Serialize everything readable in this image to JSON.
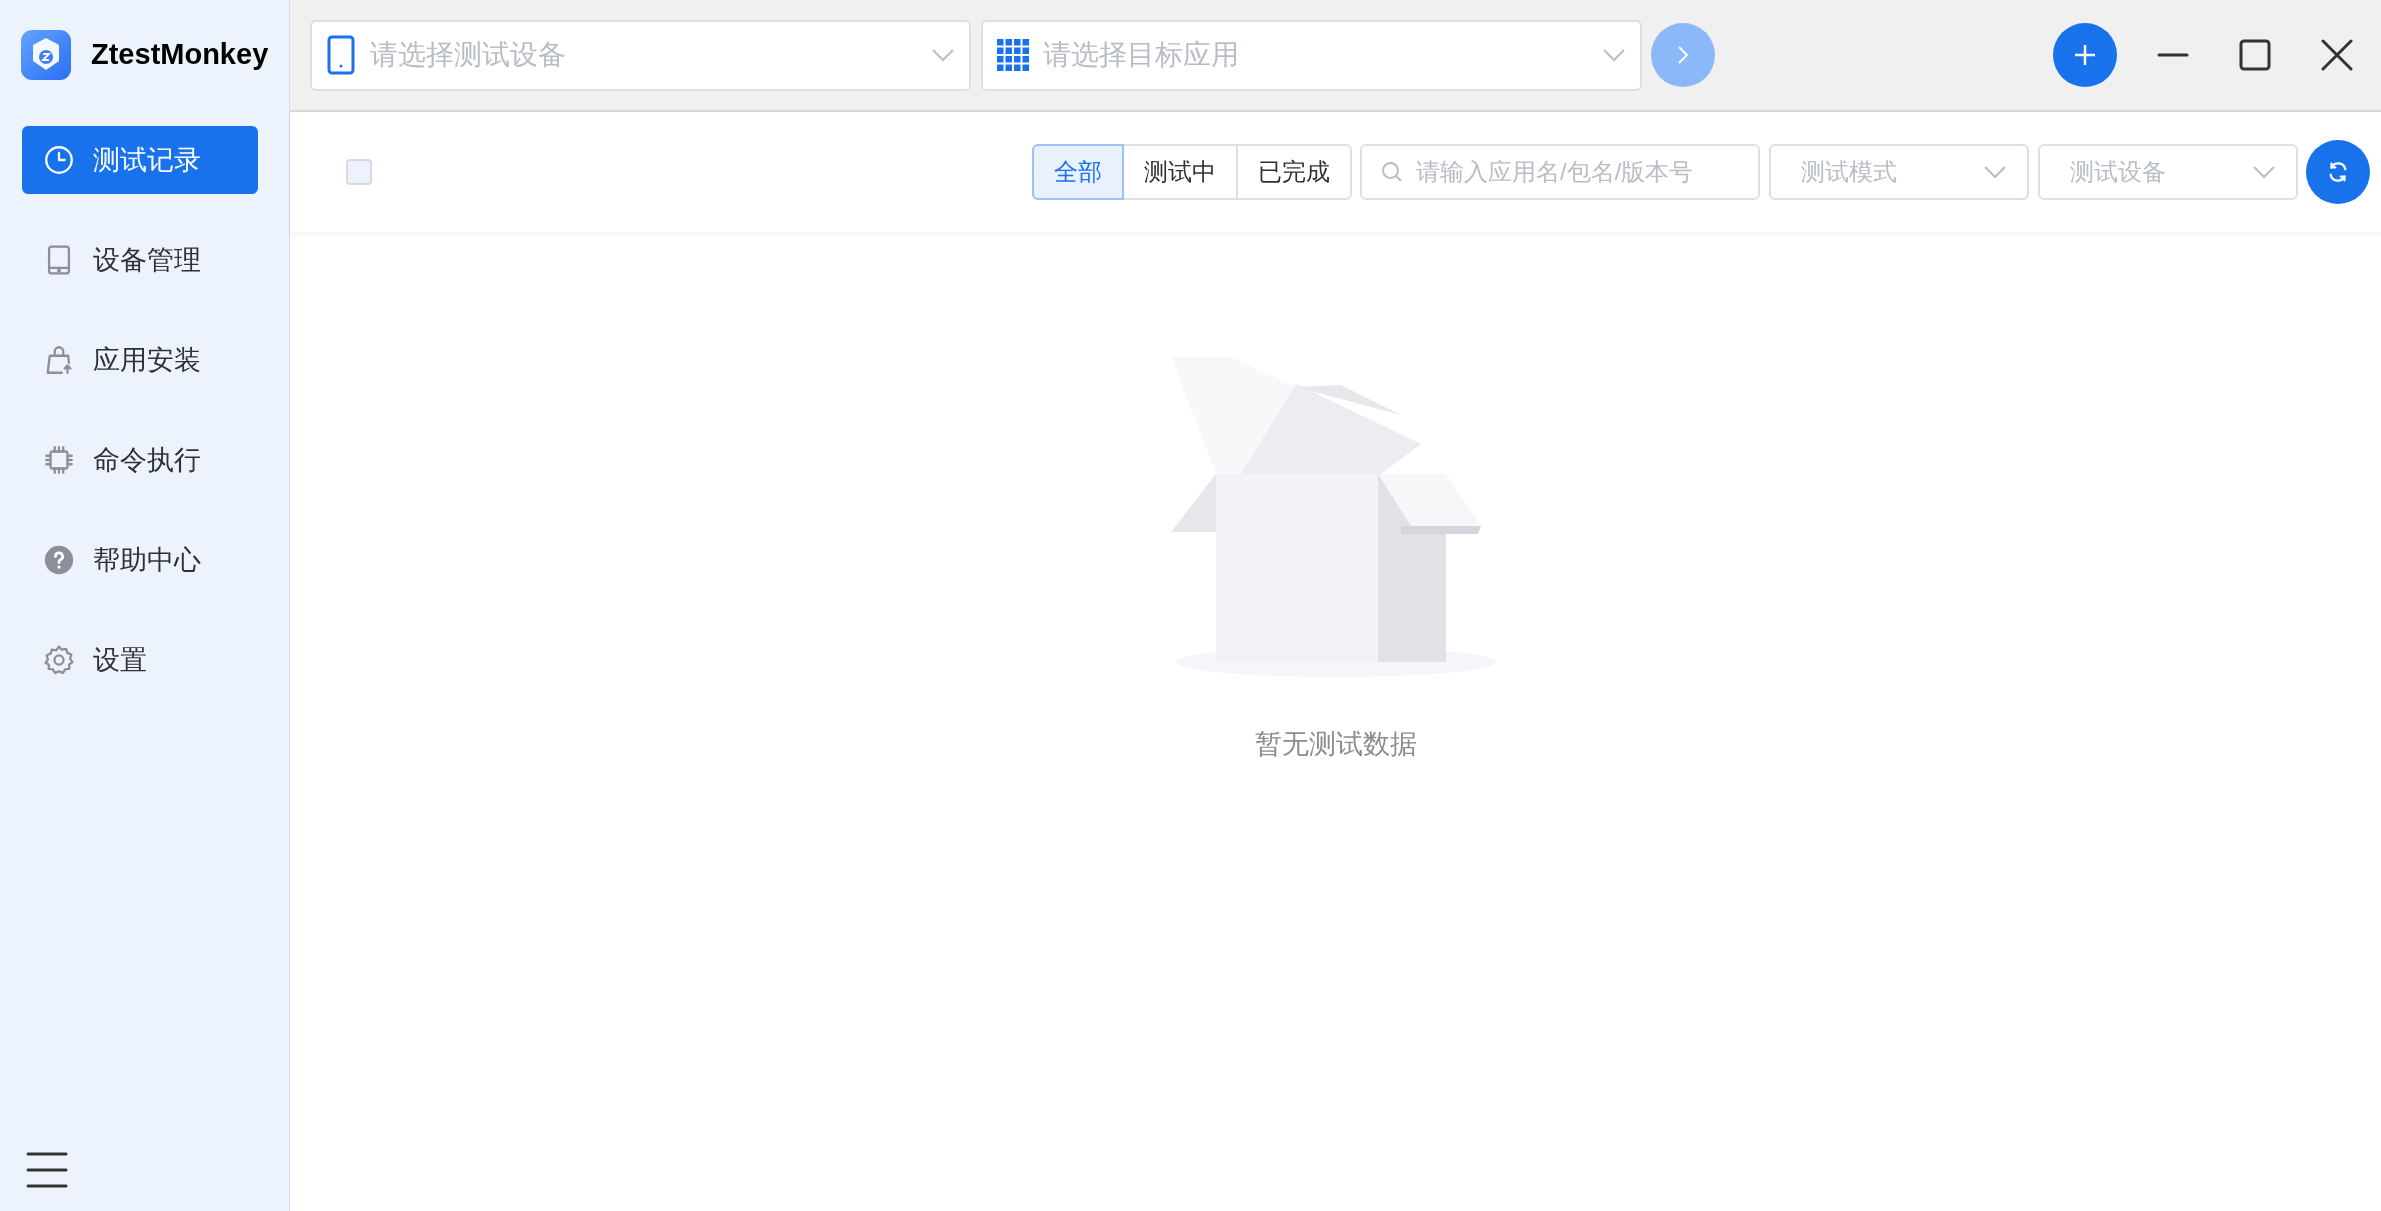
{
  "app": {
    "name": "ZtestMonkey"
  },
  "sidebar": {
    "items": [
      {
        "label": "测试记录",
        "kind": "clock",
        "selected": true
      },
      {
        "label": "设备管理",
        "kind": "tablet",
        "selected": false
      },
      {
        "label": "应用安装",
        "kind": "bag",
        "selected": false
      },
      {
        "label": "命令执行",
        "kind": "chip",
        "selected": false
      },
      {
        "label": "帮助中心",
        "kind": "help",
        "selected": false
      },
      {
        "label": "设置",
        "kind": "gear",
        "selected": false
      }
    ]
  },
  "topbar": {
    "device_select": {
      "placeholder": "请选择测试设备"
    },
    "app_select": {
      "placeholder": "请选择目标应用"
    }
  },
  "toolbar": {
    "select_all": {
      "checked": false
    },
    "status_tabs": [
      {
        "label": "全部",
        "selected": true
      },
      {
        "label": "测试中",
        "selected": false
      },
      {
        "label": "已完成",
        "selected": false
      }
    ],
    "search": {
      "placeholder": "请输入应用名/包名/版本号"
    },
    "filters": [
      {
        "placeholder": "测试模式"
      },
      {
        "placeholder": "测试设备"
      }
    ]
  },
  "empty_state": {
    "message": "暂无测试数据"
  }
}
